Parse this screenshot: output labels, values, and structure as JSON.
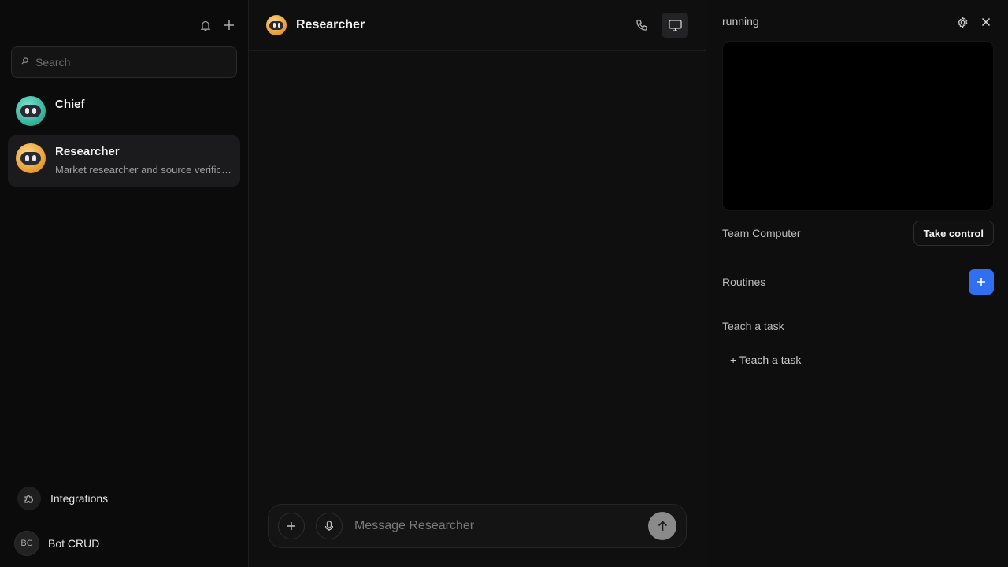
{
  "sidebar": {
    "search_placeholder": "Search",
    "top_icons": [
      "bell-icon",
      "plus-icon"
    ],
    "agents": [
      {
        "name": "Chief",
        "description": "",
        "avatar_color": "#3cbfa8",
        "active": false
      },
      {
        "name": "Researcher",
        "description": "Market researcher and source verification",
        "avatar_color": "#f0a83a",
        "active": true
      }
    ],
    "integrations_label": "Integrations",
    "user": {
      "initials": "BC",
      "name": "Bot CRUD"
    }
  },
  "chat": {
    "title": "Researcher",
    "header_icons": [
      "phone-icon",
      "monitor-icon"
    ],
    "composer_placeholder": "Message Researcher"
  },
  "panel": {
    "status": "running",
    "computer_label": "Team Computer",
    "take_control_label": "Take control",
    "routines_label": "Routines",
    "teach_section_label": "Teach a task",
    "teach_link_label": "+ Teach a task"
  },
  "colors": {
    "accent": "#2f6ff0",
    "background": "#0e0e0e",
    "chief_avatar": "#3cbfa8",
    "researcher_avatar": "#f0a83a"
  }
}
